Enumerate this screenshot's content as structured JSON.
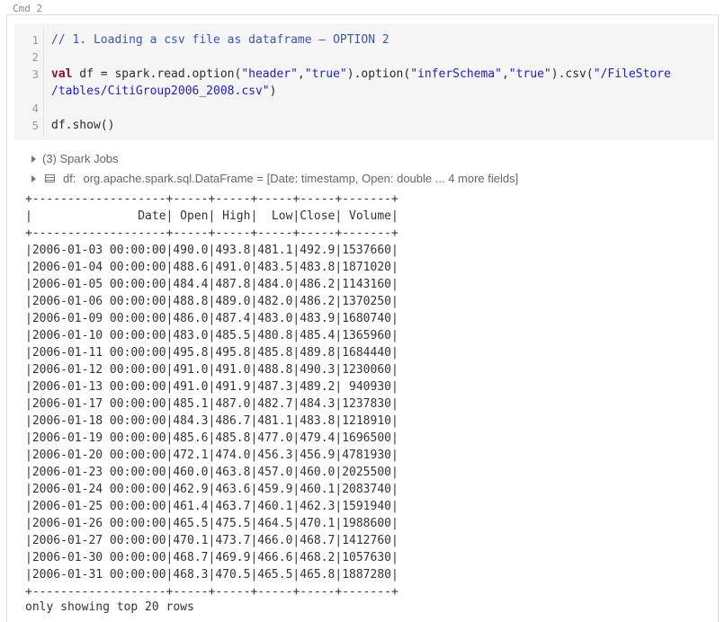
{
  "cell": {
    "label": "Cmd 2"
  },
  "editor": {
    "line_numbers": [
      "1",
      "2",
      "3",
      "",
      "4",
      "5"
    ],
    "comment": "// 1. Loading a csv file as dataframe – OPTION 2",
    "kw_val": "val",
    "code_a": " df = spark.read.option(",
    "str_header": "\"header\"",
    "comma1": ",",
    "str_true1": "\"true\"",
    "code_b": ").option(",
    "str_infer": "\"inferSchema\"",
    "comma2": ",",
    "str_true2": "\"true\"",
    "code_c": ").csv(",
    "str_path1": "\"/FileStore",
    "str_path2": "/tables/CitiGroup2006_2008.csv\"",
    "code_d": ")",
    "show": "df.show()"
  },
  "output": {
    "spark_jobs": "(3) Spark Jobs",
    "df_name": "df:",
    "df_schema": "org.apache.spark.sql.DataFrame = [Date: timestamp, Open: double ... 4 more fields]",
    "table_border": "+-------------------+-----+-----+-----+-----+-------+",
    "table_header": "|               Date| Open| High|  Low|Close| Volume|",
    "rows": [
      "|2006-01-03 00:00:00|490.0|493.8|481.1|492.9|1537660|",
      "|2006-01-04 00:00:00|488.6|491.0|483.5|483.8|1871020|",
      "|2006-01-05 00:00:00|484.4|487.8|484.0|486.2|1143160|",
      "|2006-01-06 00:00:00|488.8|489.0|482.0|486.2|1370250|",
      "|2006-01-09 00:00:00|486.0|487.4|483.0|483.9|1680740|",
      "|2006-01-10 00:00:00|483.0|485.5|480.8|485.4|1365960|",
      "|2006-01-11 00:00:00|495.8|495.8|485.8|489.8|1684440|",
      "|2006-01-12 00:00:00|491.0|491.0|488.8|490.3|1230060|",
      "|2006-01-13 00:00:00|491.0|491.9|487.3|489.2| 940930|",
      "|2006-01-17 00:00:00|485.1|487.0|482.7|484.3|1237830|",
      "|2006-01-18 00:00:00|484.3|486.7|481.1|483.8|1218910|",
      "|2006-01-19 00:00:00|485.6|485.8|477.0|479.4|1696500|",
      "|2006-01-20 00:00:00|472.1|474.0|456.3|456.9|4781930|",
      "|2006-01-23 00:00:00|460.0|463.8|457.0|460.0|2025500|",
      "|2006-01-24 00:00:00|462.9|463.6|459.9|460.1|2083740|",
      "|2006-01-25 00:00:00|461.4|463.7|460.1|462.3|1591940|",
      "|2006-01-26 00:00:00|465.5|475.5|464.5|470.1|1988600|",
      "|2006-01-27 00:00:00|470.1|473.7|466.0|468.7|1412760|",
      "|2006-01-30 00:00:00|468.7|469.9|466.6|468.2|1057630|",
      "|2006-01-31 00:00:00|468.3|470.5|465.5|465.8|1887280|"
    ],
    "footer": "only showing top 20 rows"
  }
}
